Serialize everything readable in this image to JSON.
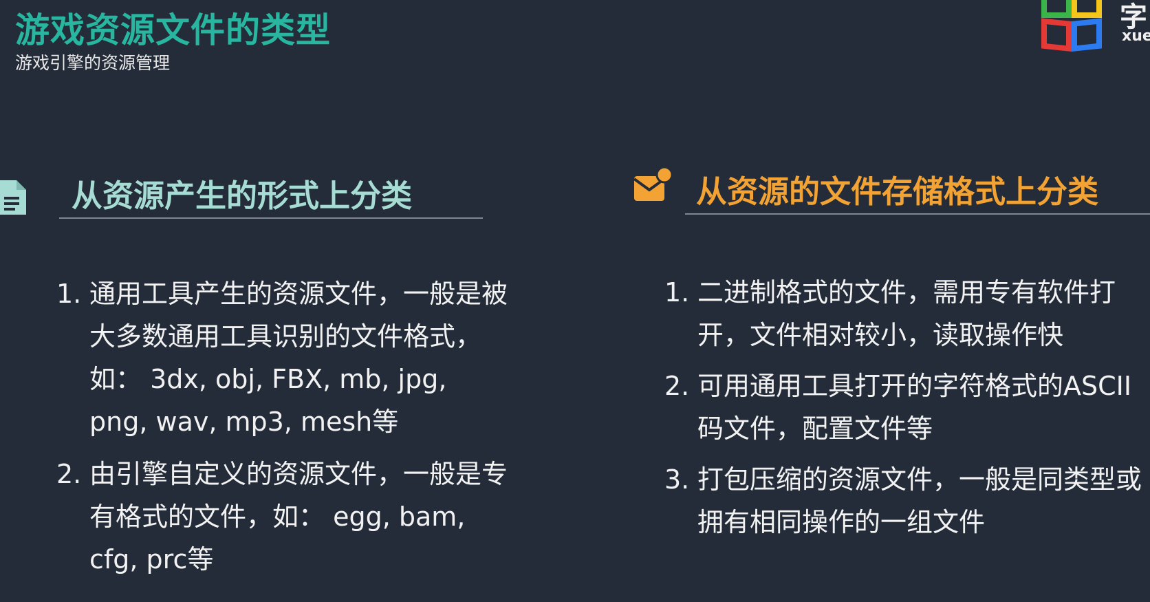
{
  "header": {
    "title": "游戏资源文件的类型",
    "subtitle": "游戏引擎的资源管理"
  },
  "logo": {
    "icon": "colorful-cubes-logo-icon",
    "text": "字",
    "sub_text": "xue"
  },
  "left_section": {
    "icon": "document-icon",
    "title": "从资源产生的形式上分类",
    "items": [
      {
        "num": "1.",
        "text": "通用工具产生的资源文件，一般是被大多数通用工具识别的文件格式，如： 3dx, obj, FBX, mb, jpg, png, wav, mp3, mesh等"
      },
      {
        "num": "2.",
        "text": "由引擎自定义的资源文件，一般是专有格式的文件，如： egg, bam, cfg, prc等"
      }
    ]
  },
  "right_section": {
    "icon": "mail-notification-icon",
    "title": "从资源的文件存储格式上分类",
    "items": [
      {
        "num": "1.",
        "text": "二进制格式的文件，需用专有软件打开，文件相对较小，读取操作快"
      },
      {
        "num": "2.",
        "text": "可用通用工具打开的字符格式的ASCII码文件，配置文件等"
      },
      {
        "num": "3.",
        "text": "打包压缩的资源文件，一般是同类型或拥有相同操作的一组文件"
      }
    ]
  },
  "colors": {
    "background": "#232c38",
    "title": "#29b6a0",
    "left_heading": "#a7dcd4",
    "right_heading": "#f3a334",
    "body_text": "#f2f2f2"
  }
}
